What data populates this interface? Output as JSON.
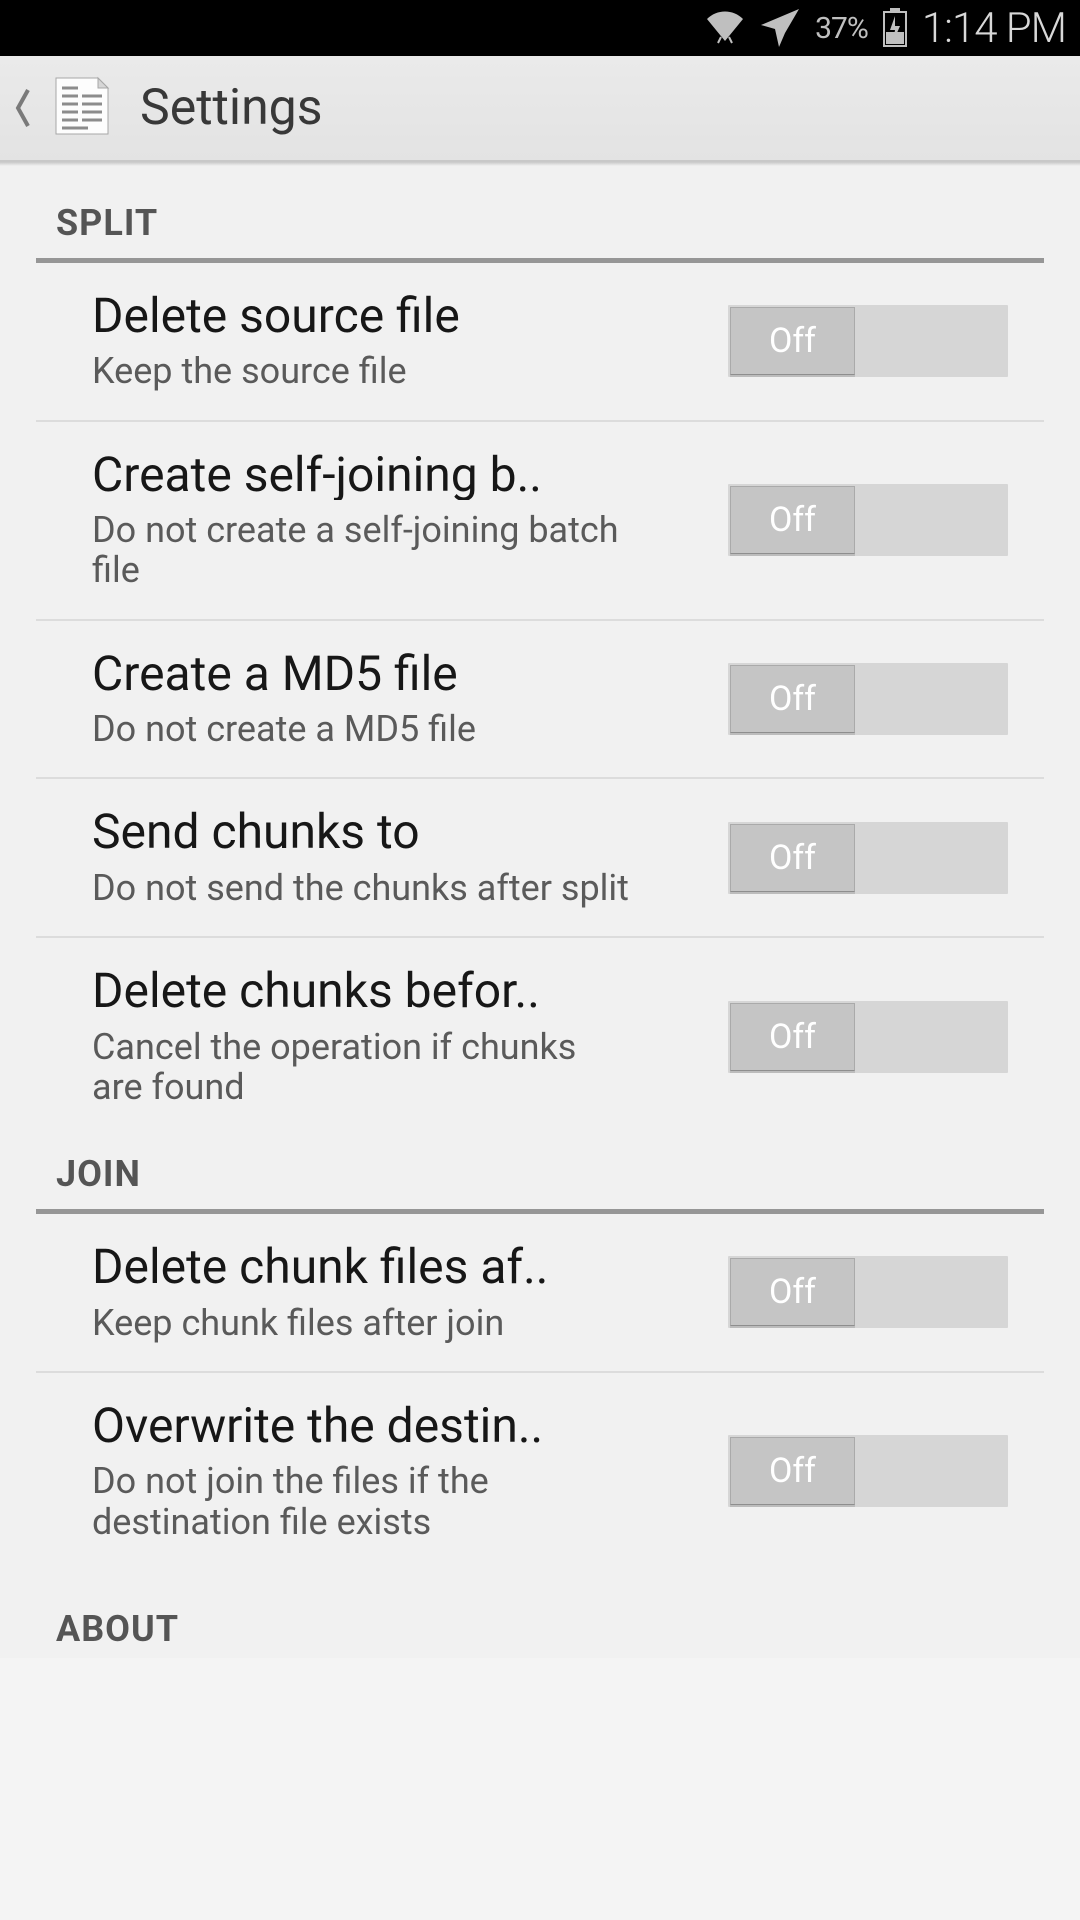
{
  "status_bar": {
    "battery_pct": "37%",
    "time": "1:14 PM"
  },
  "header": {
    "title": "Settings"
  },
  "sections": {
    "split": {
      "label": "SPLIT",
      "items": [
        {
          "title": "Delete source file",
          "subtitle": "Keep the source file",
          "toggle": "Off"
        },
        {
          "title": "Create self-joining b..",
          "subtitle": "Do not create a self-joining batch file",
          "toggle": "Off"
        },
        {
          "title": "Create a MD5 file",
          "subtitle": "Do not create a MD5 file",
          "toggle": "Off"
        },
        {
          "title": "Send chunks to",
          "subtitle": "Do not send the chunks after split",
          "toggle": "Off"
        },
        {
          "title": "Delete chunks befor..",
          "subtitle": "Cancel the operation if chunks are found",
          "toggle": "Off"
        }
      ]
    },
    "join": {
      "label": "JOIN",
      "items": [
        {
          "title": "Delete chunk files af..",
          "subtitle": "Keep chunk files after join",
          "toggle": "Off"
        },
        {
          "title": "Overwrite the destin..",
          "subtitle": "Do not join the files if the destination file exists",
          "toggle": "Off"
        }
      ]
    },
    "about": {
      "label": "ABOUT"
    }
  }
}
